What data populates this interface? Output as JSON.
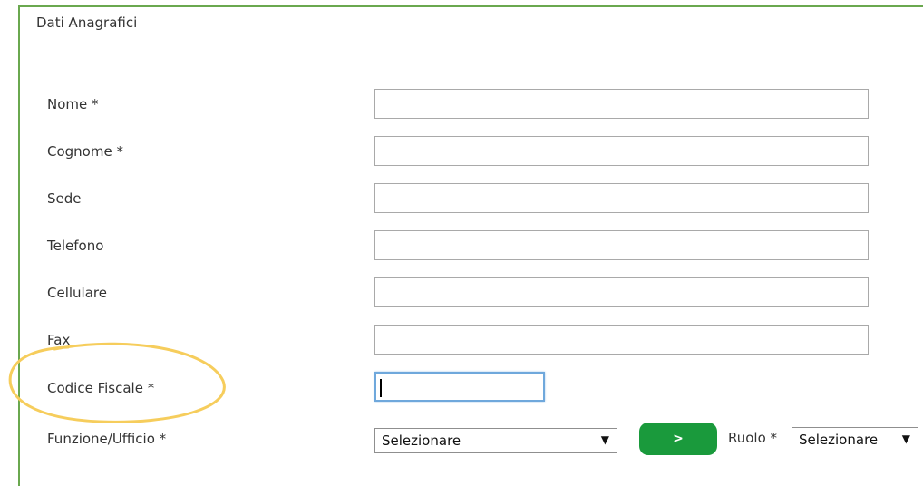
{
  "section": {
    "title": "Dati Anagrafici"
  },
  "fields": [
    {
      "label": "Nome *",
      "value": ""
    },
    {
      "label": "Cognome *",
      "value": ""
    },
    {
      "label": "Sede",
      "value": ""
    },
    {
      "label": "Telefono",
      "value": ""
    },
    {
      "label": "Cellulare",
      "value": ""
    },
    {
      "label": "Fax",
      "value": ""
    },
    {
      "label": "Codice Fiscale *",
      "value": ""
    }
  ],
  "funzione": {
    "label": "Funzione/Ufficio *",
    "selected": "Selezionare"
  },
  "go_button": {
    "label": ">"
  },
  "ruolo": {
    "label": "Ruolo *",
    "selected": "Selezionare"
  },
  "icons": {
    "dropdown": "chevron-down-icon"
  },
  "colors": {
    "panel_border": "#6aa84f",
    "button_bg": "#1a9a3c",
    "highlight": "#f6cd5c",
    "focus_border": "#6fa8dc"
  }
}
